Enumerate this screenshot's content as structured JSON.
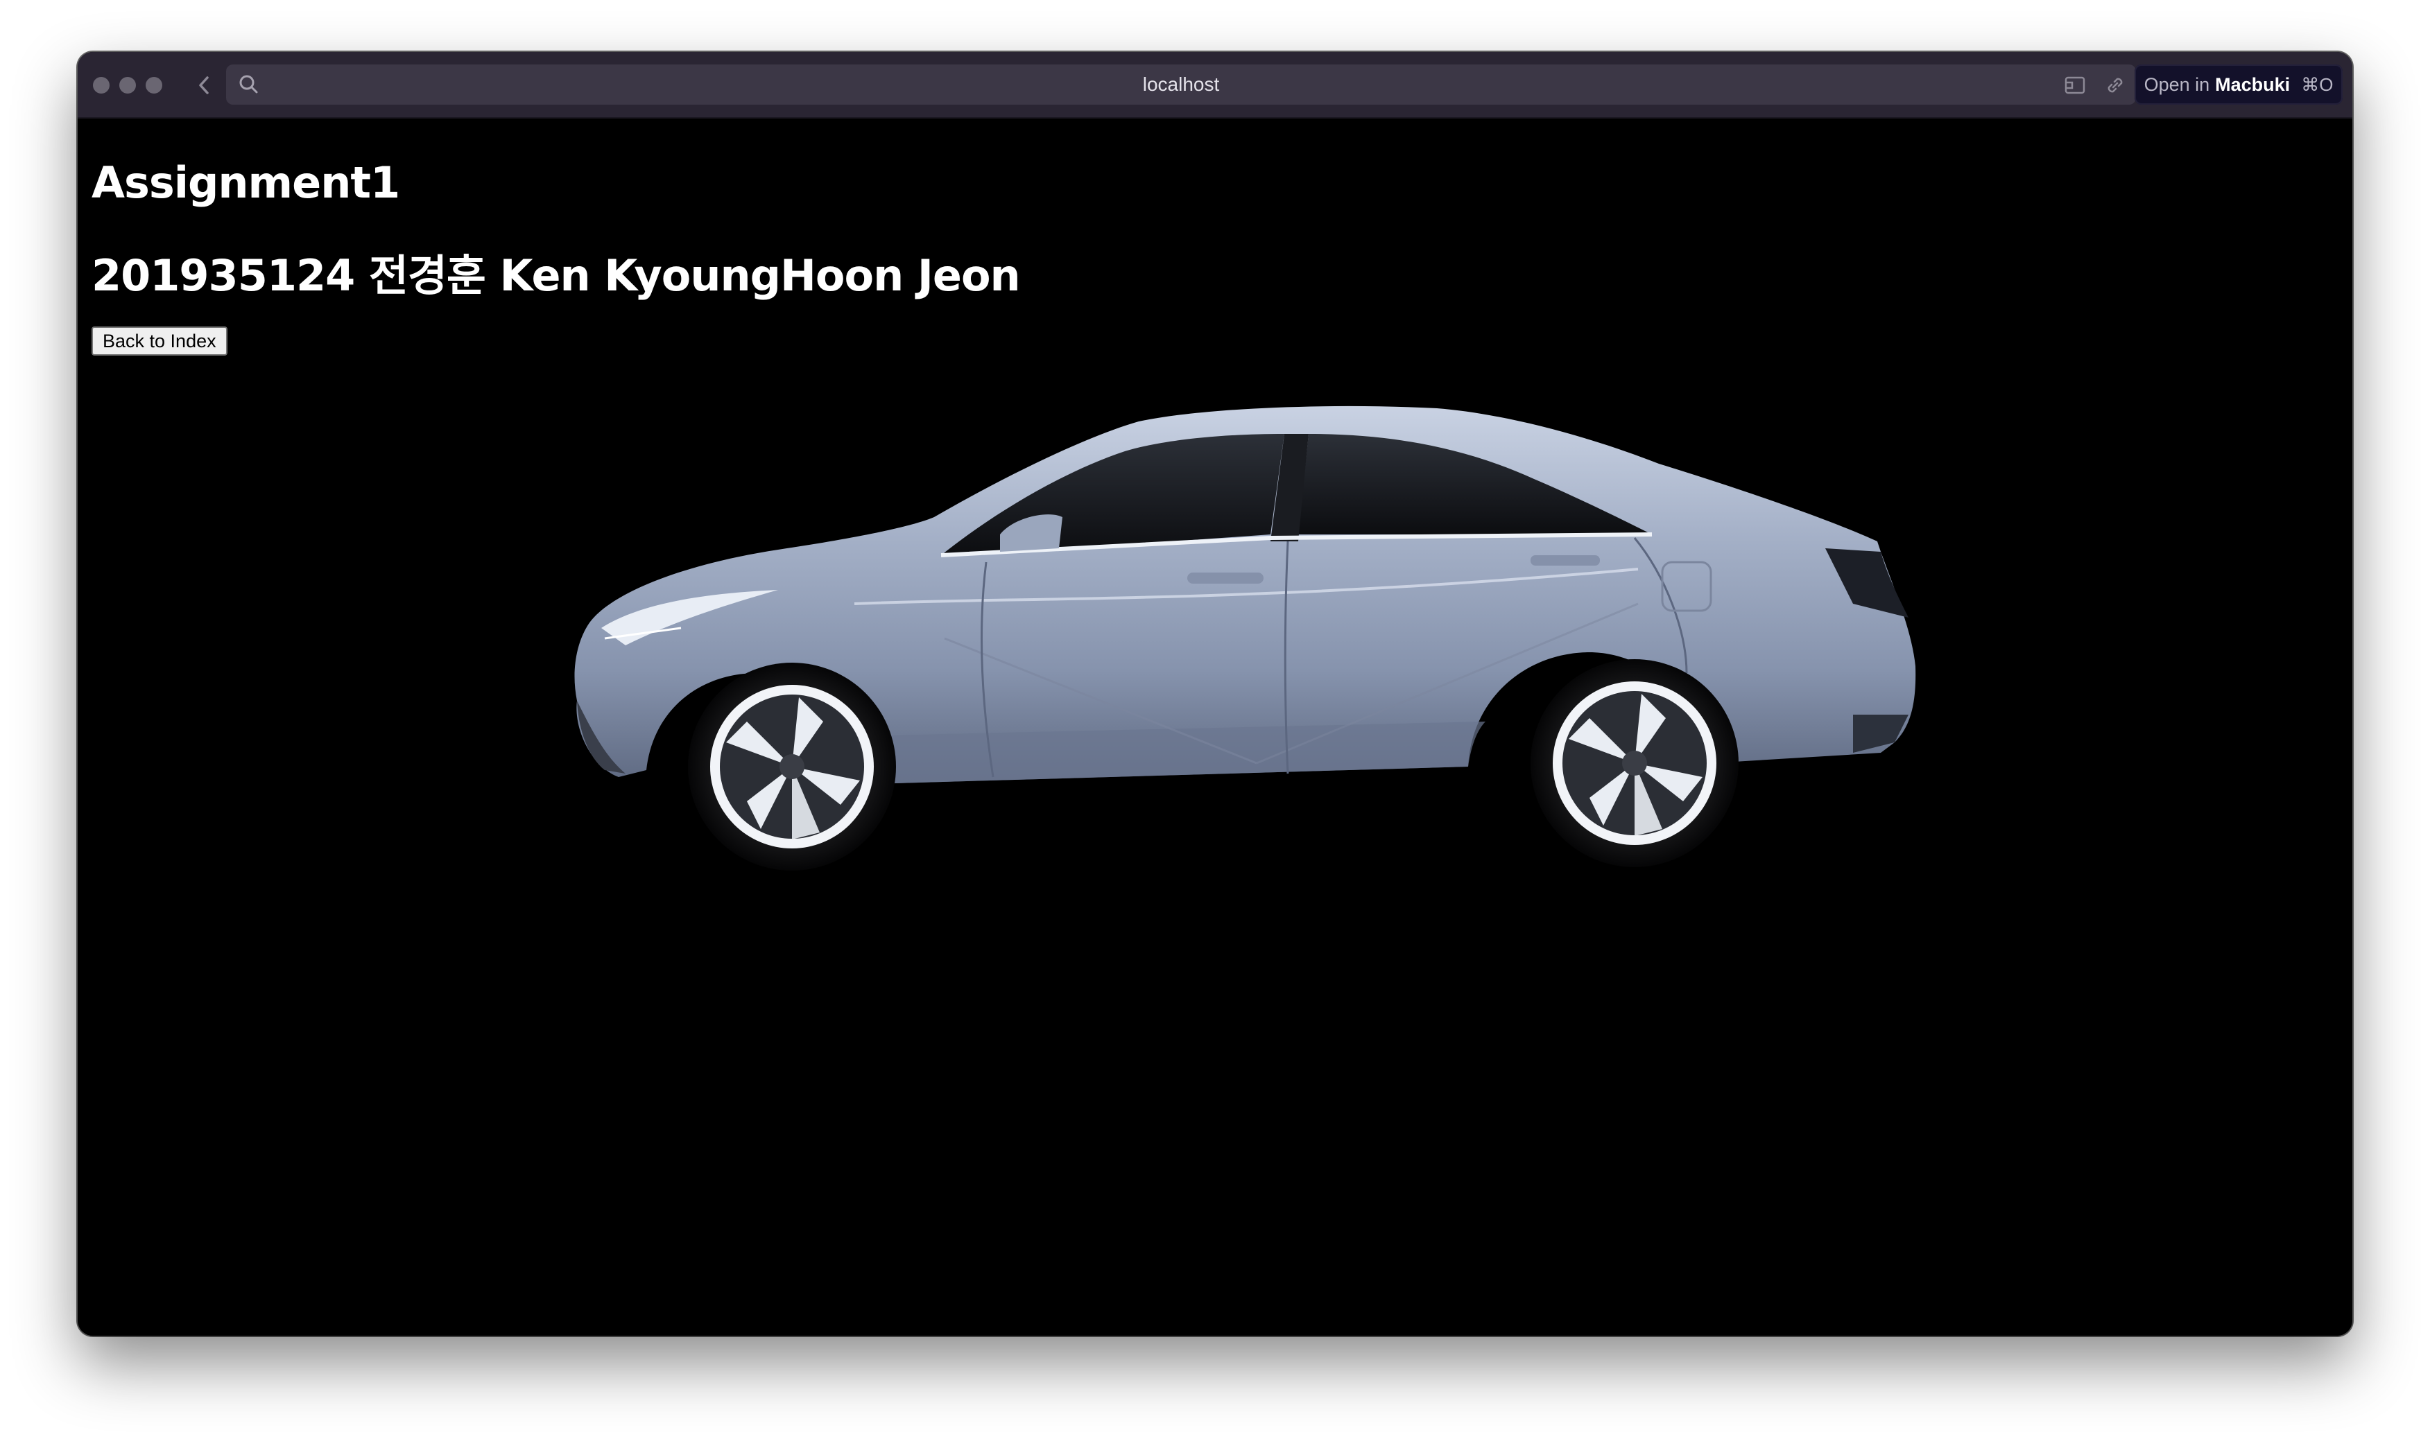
{
  "browser": {
    "url": "localhost",
    "open_in_label": "Open in",
    "open_in_app": "Macbuki",
    "open_in_shortcut": "⌘O",
    "icons": [
      "back-chevron-icon",
      "search-icon",
      "cast-icon",
      "link-icon"
    ]
  },
  "page": {
    "title": "Assignment1",
    "subtitle": "201935124 전경훈 Ken KyoungHoon Jeon",
    "back_button_label": "Back to Index"
  },
  "scene": {
    "object": "car-model",
    "background_color": "#000000",
    "body_color": "#9aa7bf"
  }
}
